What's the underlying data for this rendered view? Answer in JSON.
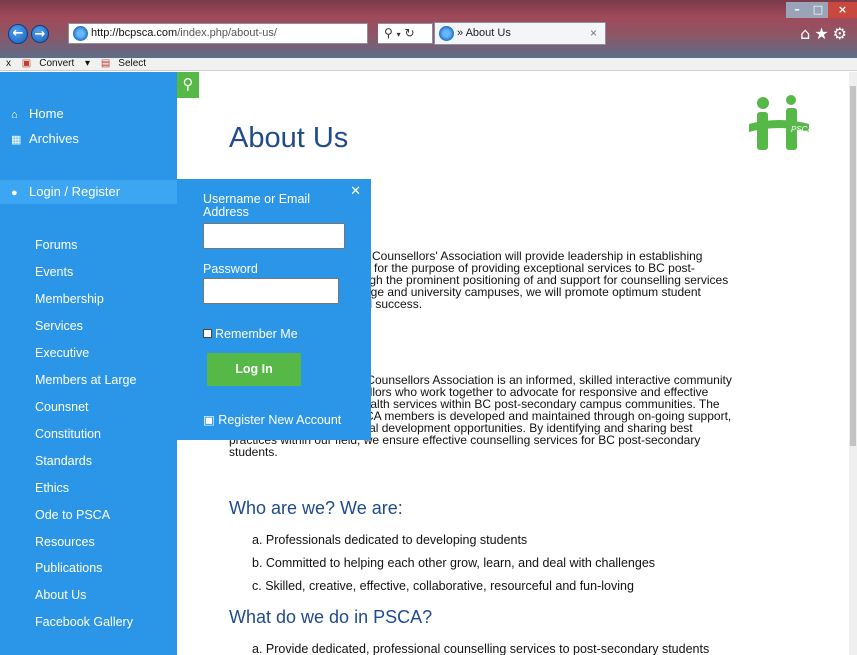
{
  "browser": {
    "url_domain": "http://bcpsca.com",
    "url_path": "/index.php/about-us/",
    "tab_title": "» About Us",
    "command_bar": {
      "close": "x",
      "convert": "Convert",
      "select": "Select"
    }
  },
  "sidebar": {
    "top_links": [
      {
        "label": "Home",
        "icon": "home-icon"
      },
      {
        "label": "Archives",
        "icon": "calendar-icon"
      }
    ],
    "login_label": "Login / Register",
    "items": [
      "Forums",
      "Events",
      "Membership",
      "Services",
      "Executive",
      "Members at Large",
      "Counsnet",
      "Constitution",
      "Standards",
      "Ethics",
      "Ode to PSCA",
      "Resources",
      "Publications",
      "About Us",
      "Facebook Gallery"
    ]
  },
  "login": {
    "username_label": "Username or Email Address",
    "password_label": "Password",
    "remember_label": "Remember Me",
    "login_button": "Log In",
    "register_label": "Register New Account",
    "username_value": "",
    "password_value": ""
  },
  "main": {
    "title": "About Us",
    "para1": [
      "ary Counsellors' Association will provide leadership in establishing",
      "ces for the purpose of providing exceptional services to BC post-",
      "rough the prominent positioning of and support for counselling services",
      "ollege and university campuses, we will promote optimum student",
      "and success."
    ],
    "para2": [
      "y Counsellors Association is an informed, skilled interactive community",
      "sellors who work together to advocate for responsive and effective",
      "health services within BC post-secondary campus communities. The",
      "SCA members is developed and maintained through on-going support,",
      "networking and professional development opportunities. By identifying and sharing best",
      "practices within our field, we ensure effective counselling services for BC post-secondary",
      "students."
    ],
    "heading1": "Who are we? We are:",
    "list1": [
      "a.  Professionals dedicated to developing students",
      "b.  Committed to helping each other grow, learn, and deal with challenges",
      "c.  Skilled, creative, effective, collaborative, resourceful and fun-loving"
    ],
    "heading2": "What do we do in PSCA?",
    "list2": [
      "a.  Provide dedicated, professional counselling services to post-secondary students"
    ],
    "logo_text": "PSCA"
  },
  "colors": {
    "sidebar": "#2b96e8",
    "accent_green": "#56b947",
    "heading_blue": "#1f4a8c"
  }
}
